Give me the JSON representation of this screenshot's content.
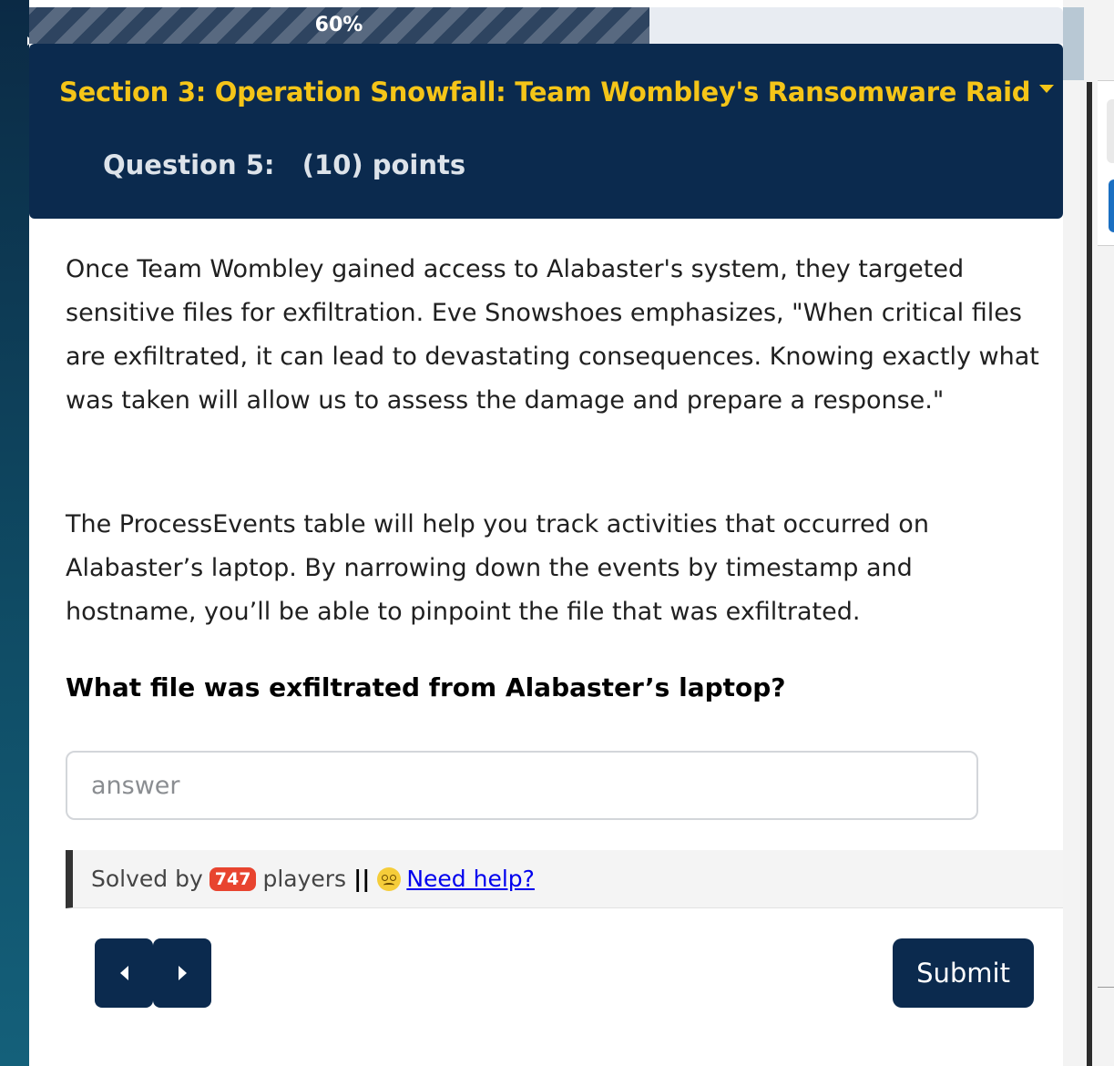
{
  "progress": {
    "value": 0.6,
    "label": "60%"
  },
  "section": {
    "title": "Section 3: Operation Snowfall: Team Wombley's Ransomware Raid",
    "question_label": "Question 5:",
    "points_label": "(10) points"
  },
  "content": {
    "paragraph1": "Once Team Wombley gained access to Alabaster's system, they targeted sensitive files for exfiltration. Eve Snowshoes emphasizes, \"When critical files are exfiltrated, it can lead to devastating consequences. Knowing exactly what was taken will allow us to assess the damage and prepare a response.\"",
    "paragraph2": "The ProcessEvents table will help you track activities that occurred on Alabaster’s laptop. By narrowing down the events by timestamp and hostname, you’ll be able to pinpoint the file that was exfiltrated.",
    "question": "What file was exfiltrated from Alabaster’s laptop?"
  },
  "answer": {
    "placeholder": "answer",
    "value": ""
  },
  "help": {
    "solved_prefix": "Solved by",
    "solved_count": "747",
    "solved_suffix": "players",
    "separator": "||",
    "emoji_icon": "dizzy-face-icon",
    "link_label": " Need help?"
  },
  "nav": {
    "prev_icon": "caret-left-icon",
    "next_icon": "caret-right-icon"
  },
  "submit_label": "Submit",
  "colors": {
    "header_bg": "#0b2a4e",
    "title_accent": "#f5c518",
    "badge_red": "#e8442f",
    "link_blue": "#0000ee"
  }
}
